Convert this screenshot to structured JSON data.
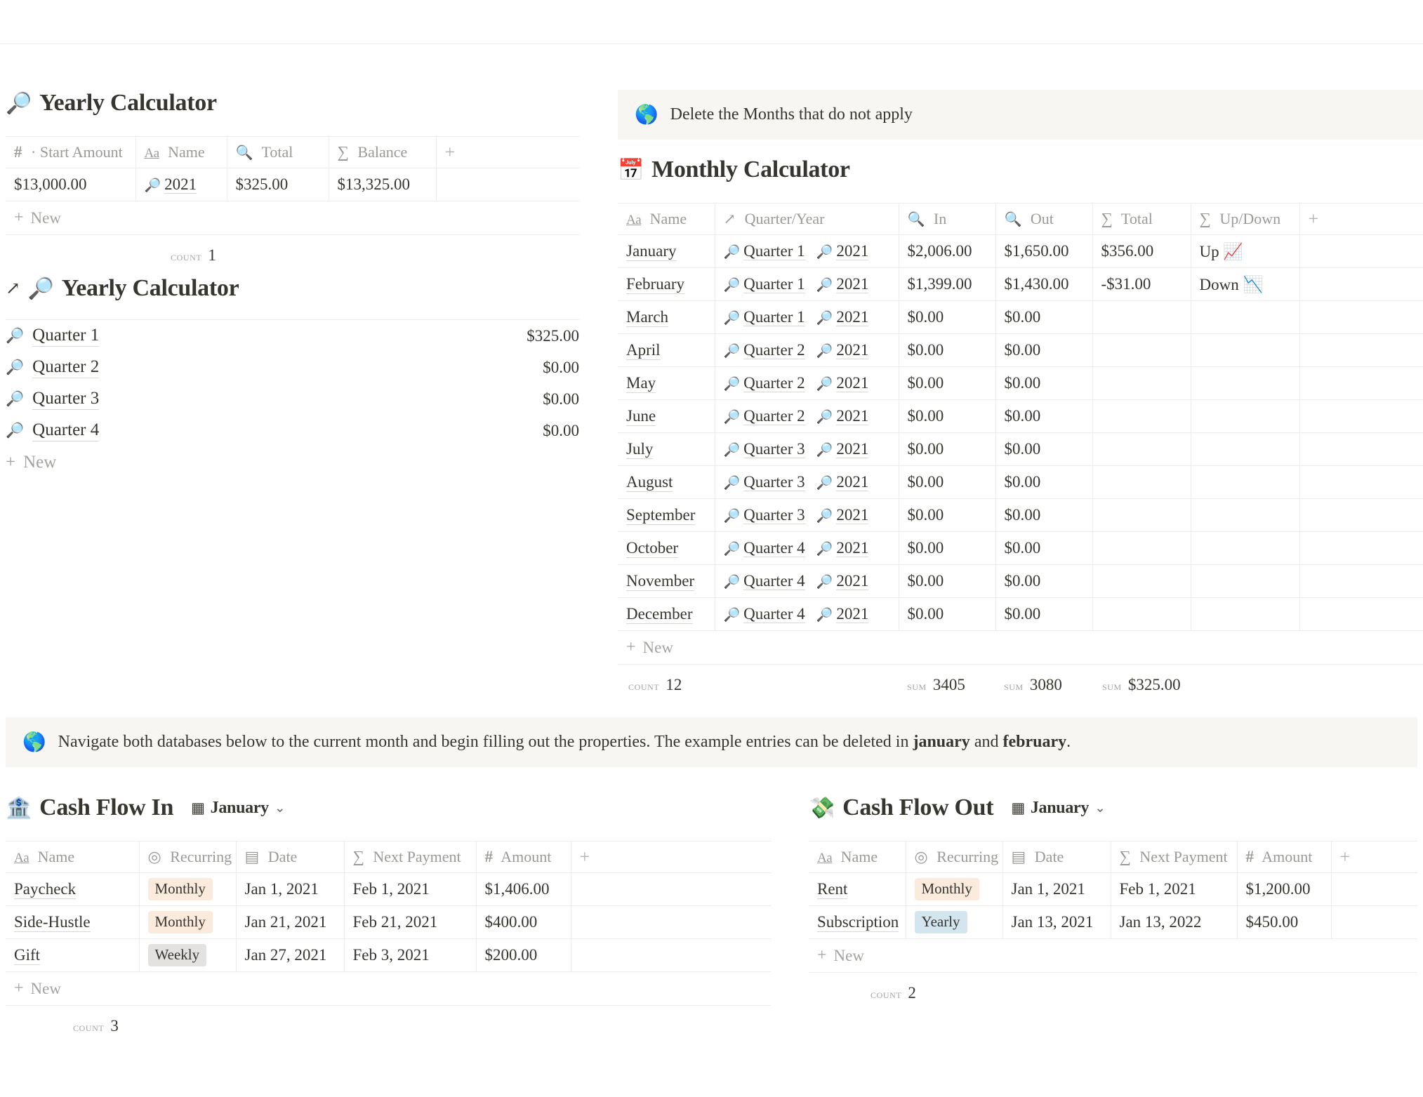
{
  "yearly_calculator_table": {
    "title": "Yearly Calculator",
    "icon": "magnifying-glass",
    "icon_glyph": "🔎",
    "columns": [
      {
        "label": "Start Amount",
        "type_icon": "number",
        "glyph": "#",
        "prefix": "·"
      },
      {
        "label": "Name",
        "type_icon": "title",
        "glyph": "Aa"
      },
      {
        "label": "Total",
        "type_icon": "rollup",
        "glyph": "🔍"
      },
      {
        "label": "Balance",
        "type_icon": "formula",
        "glyph": "∑"
      }
    ],
    "add_column_label": "+",
    "rows": [
      {
        "start_amount": "$13,000.00",
        "name": "2021",
        "name_icon": "🔎",
        "total": "$325.00",
        "balance": "$13,325.00"
      }
    ],
    "new_row_label": "New",
    "summary": {
      "count_label": "COUNT",
      "count_value": "1"
    }
  },
  "yearly_calculator_relation": {
    "title": "Yearly Calculator",
    "open_icon": "arrow-up-right",
    "icon_glyph": "🔎",
    "items": [
      {
        "icon": "🔎",
        "name": "Quarter 1",
        "amount": "$325.00"
      },
      {
        "icon": "🔎",
        "name": "Quarter 2",
        "amount": "$0.00"
      },
      {
        "icon": "🔎",
        "name": "Quarter 3",
        "amount": "$0.00"
      },
      {
        "icon": "🔎",
        "name": "Quarter 4",
        "amount": "$0.00"
      }
    ],
    "new_label": "New"
  },
  "months_callout": {
    "icon": "globe",
    "icon_glyph": "🌎",
    "text": "Delete the Months that do not apply"
  },
  "monthly_calculator": {
    "title": "Monthly Calculator",
    "icon": "calendar",
    "icon_glyph": "📅",
    "columns": [
      {
        "label": "Name",
        "glyph": "Aa"
      },
      {
        "label": "Quarter/Year",
        "glyph": "↗"
      },
      {
        "label": "In",
        "glyph": "🔍"
      },
      {
        "label": "Out",
        "glyph": "🔍"
      },
      {
        "label": "Total",
        "glyph": "∑"
      },
      {
        "label": "Up/Down",
        "glyph": "∑"
      }
    ],
    "add_column_label": "+",
    "rows": [
      {
        "name": "January",
        "quarter": "Quarter 1",
        "year": "2021",
        "in": "$2,006.00",
        "out": "$1,650.00",
        "total": "$356.00",
        "updown": "Up",
        "updown_emoji": "📈"
      },
      {
        "name": "February",
        "quarter": "Quarter 1",
        "year": "2021",
        "in": "$1,399.00",
        "out": "$1,430.00",
        "total": "-$31.00",
        "updown": "Down",
        "updown_emoji": "📉"
      },
      {
        "name": "March",
        "quarter": "Quarter 1",
        "year": "2021",
        "in": "$0.00",
        "out": "$0.00",
        "total": "",
        "updown": "",
        "updown_emoji": ""
      },
      {
        "name": "April",
        "quarter": "Quarter 2",
        "year": "2021",
        "in": "$0.00",
        "out": "$0.00",
        "total": "",
        "updown": "",
        "updown_emoji": ""
      },
      {
        "name": "May",
        "quarter": "Quarter 2",
        "year": "2021",
        "in": "$0.00",
        "out": "$0.00",
        "total": "",
        "updown": "",
        "updown_emoji": ""
      },
      {
        "name": "June",
        "quarter": "Quarter 2",
        "year": "2021",
        "in": "$0.00",
        "out": "$0.00",
        "total": "",
        "updown": "",
        "updown_emoji": ""
      },
      {
        "name": "July",
        "quarter": "Quarter 3",
        "year": "2021",
        "in": "$0.00",
        "out": "$0.00",
        "total": "",
        "updown": "",
        "updown_emoji": ""
      },
      {
        "name": "August",
        "quarter": "Quarter 3",
        "year": "2021",
        "in": "$0.00",
        "out": "$0.00",
        "total": "",
        "updown": "",
        "updown_emoji": ""
      },
      {
        "name": "September",
        "quarter": "Quarter 3",
        "year": "2021",
        "in": "$0.00",
        "out": "$0.00",
        "total": "",
        "updown": "",
        "updown_emoji": ""
      },
      {
        "name": "October",
        "quarter": "Quarter 4",
        "year": "2021",
        "in": "$0.00",
        "out": "$0.00",
        "total": "",
        "updown": "",
        "updown_emoji": ""
      },
      {
        "name": "November",
        "quarter": "Quarter 4",
        "year": "2021",
        "in": "$0.00",
        "out": "$0.00",
        "total": "",
        "updown": "",
        "updown_emoji": ""
      },
      {
        "name": "December",
        "quarter": "Quarter 4",
        "year": "2021",
        "in": "$0.00",
        "out": "$0.00",
        "total": "",
        "updown": "",
        "updown_emoji": ""
      }
    ],
    "new_row_label": "New",
    "summary": {
      "count_label": "COUNT",
      "count_value": "12",
      "sum_in_label": "SUM",
      "sum_in_value": "3405",
      "sum_out_label": "SUM",
      "sum_out_value": "3080",
      "sum_total_label": "SUM",
      "sum_total_value": "$325.00"
    }
  },
  "navigate_callout": {
    "icon": "globe",
    "icon_glyph": "🌎",
    "text_part1": "Navigate both databases below to the current month and begin filling out the properties. The example entries can be deleted in ",
    "bold1": "january",
    "text_part2": " and ",
    "bold2": "february",
    "text_part3": "."
  },
  "cash_flow_in": {
    "title": "Cash Flow In",
    "icon": "bank",
    "icon_glyph": "🏦",
    "view": {
      "icon": "table-grid",
      "label": "January",
      "chevron": "⌄"
    },
    "columns": [
      {
        "label": "Name",
        "glyph": "Aa"
      },
      {
        "label": "Recurring",
        "glyph": "◉"
      },
      {
        "label": "Date",
        "glyph": "▤"
      },
      {
        "label": "Next Payment",
        "glyph": "∑"
      },
      {
        "label": "Amount",
        "glyph": "#"
      }
    ],
    "add_column_label": "+",
    "rows": [
      {
        "name": "Paycheck",
        "recurring": "Monthly",
        "recurring_color": "orange",
        "date": "Jan 1, 2021",
        "next_payment": "Feb 1, 2021",
        "amount": "$1,406.00"
      },
      {
        "name": "Side-Hustle",
        "recurring": "Monthly",
        "recurring_color": "orange",
        "date": "Jan 21, 2021",
        "next_payment": "Feb 21, 2021",
        "amount": "$400.00"
      },
      {
        "name": "Gift",
        "recurring": "Weekly",
        "recurring_color": "gray",
        "date": "Jan 27, 2021",
        "next_payment": "Feb 3, 2021",
        "amount": "$200.00"
      }
    ],
    "new_row_label": "New",
    "summary": {
      "count_label": "COUNT",
      "count_value": "3"
    }
  },
  "cash_flow_out": {
    "title": "Cash Flow Out",
    "icon": "money-with-wings",
    "icon_glyph": "💸",
    "view": {
      "icon": "table-grid",
      "label": "January",
      "chevron": "⌄"
    },
    "columns": [
      {
        "label": "Name",
        "glyph": "Aa"
      },
      {
        "label": "Recurring",
        "glyph": "◉"
      },
      {
        "label": "Date",
        "glyph": "▤"
      },
      {
        "label": "Next Payment",
        "glyph": "∑"
      },
      {
        "label": "Amount",
        "glyph": "#"
      }
    ],
    "add_column_label": "+",
    "rows": [
      {
        "name": "Rent",
        "recurring": "Monthly",
        "recurring_color": "orange",
        "date": "Jan 1, 2021",
        "next_payment": "Feb 1, 2021",
        "amount": "$1,200.00"
      },
      {
        "name": "Subscription",
        "recurring": "Yearly",
        "recurring_color": "blue",
        "date": "Jan 13, 2021",
        "next_payment": "Jan 13, 2022",
        "amount": "$450.00"
      }
    ],
    "new_row_label": "New",
    "summary": {
      "count_label": "COUNT",
      "count_value": "2"
    }
  },
  "colors": {
    "text": "#37352f",
    "muted": "#9b9a97",
    "border": "#ececeb",
    "callout_bg": "#f7f6f3",
    "tag_orange": "#faebdd",
    "tag_gray": "#e3e2e0",
    "tag_blue": "#d3e5ef"
  }
}
